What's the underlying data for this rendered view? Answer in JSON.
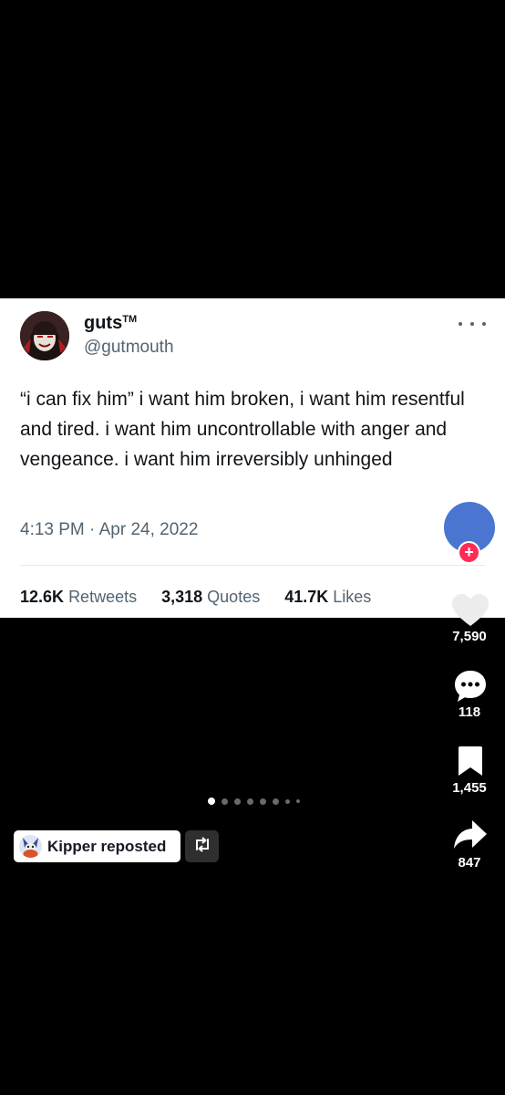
{
  "tweet": {
    "author_name": "guts",
    "author_mark": "TM",
    "author_handle": "@gutmouth",
    "text": "“i can fix him” i want him broken, i want him resentful and tired. i want him uncontrollable with anger and vengeance. i want him irreversibly unhinged",
    "timestamp": "4:13 PM · Apr 24, 2022",
    "stats": [
      {
        "value": "12.6K",
        "label": "Retweets"
      },
      {
        "value": "3,318",
        "label": "Quotes"
      },
      {
        "value": "41.7K",
        "label": "Likes"
      }
    ]
  },
  "rail": {
    "follow_symbol": "+",
    "likes": "7,590",
    "comments": "118",
    "saves": "1,455",
    "shares": "847"
  },
  "carousel": {
    "total": 8,
    "active_index": 0
  },
  "repost": {
    "label": "Kipper reposted"
  },
  "colors": {
    "accent": "#fe2c55",
    "avatar_blue": "#4a76d1",
    "secondary_text": "#536471"
  },
  "icons": {
    "heart": "heart-icon",
    "comment": "comment-icon",
    "bookmark": "bookmark-icon",
    "share": "share-icon",
    "repost": "repost-icon",
    "more": "more-icon"
  }
}
